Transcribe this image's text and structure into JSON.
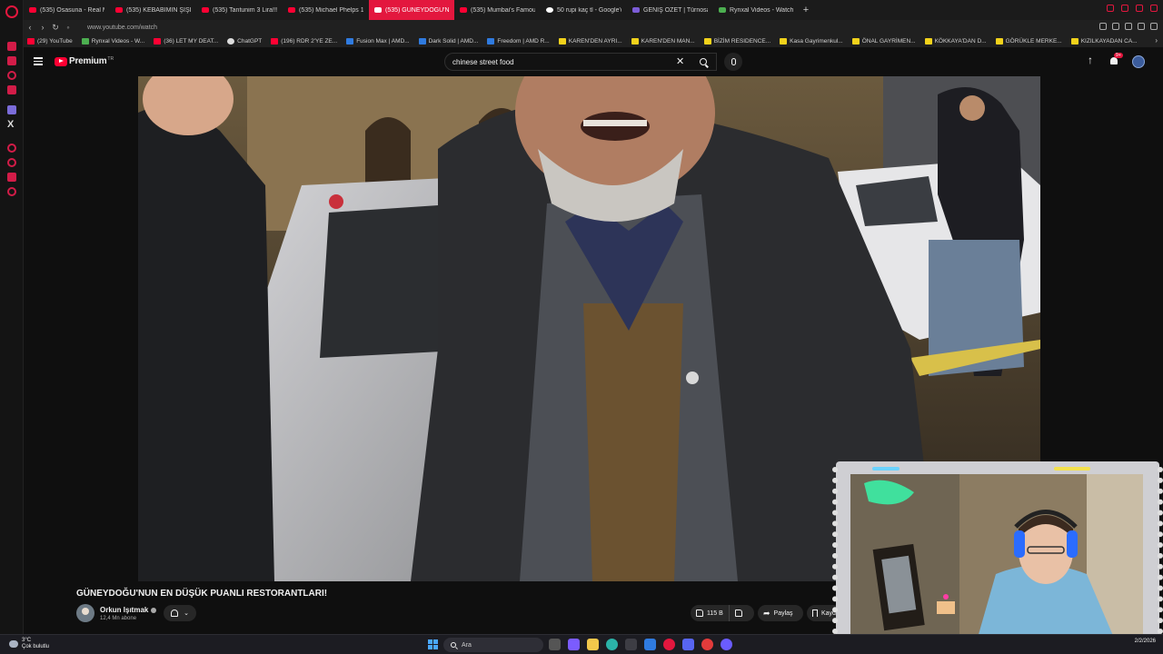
{
  "browser": {
    "tabs": [
      {
        "label": "(535) Osasuna - Real Mad",
        "icon": "youtube-icon",
        "active": false
      },
      {
        "label": "(535) KEBABIMIN ŞİŞİ 2,5",
        "icon": "youtube-icon",
        "active": false
      },
      {
        "label": "(535) Tantunim 3 Lira!!! Ç",
        "icon": "youtube-icon",
        "active": false
      },
      {
        "label": "(535) Michael Phelps 12,0",
        "icon": "youtube-icon",
        "active": false
      },
      {
        "label": "(535) GÜNEYDOĞU'N",
        "icon": "youtube-icon",
        "active": true
      },
      {
        "label": "(535) Mumbai's Famous",
        "icon": "youtube-icon",
        "active": false
      },
      {
        "label": "50 rupi kaç tl - Google'da",
        "icon": "google-icon",
        "active": false
      },
      {
        "label": "GENİŞ ÖZET | Türnosan K",
        "icon": "page-icon",
        "active": false
      },
      {
        "label": "Rynxal Videos - Watch On",
        "icon": "rynxal-icon",
        "active": false
      }
    ],
    "url": "www.youtube.com/watch",
    "bookmarks": [
      {
        "label": "(29) YouTube",
        "icon": "youtube-icon"
      },
      {
        "label": "Rynxal Videos - W...",
        "icon": "rynxal-icon"
      },
      {
        "label": "(36) LET MY DEAT...",
        "icon": "youtube-icon"
      },
      {
        "label": "ChatGPT",
        "icon": "chatgpt-icon"
      },
      {
        "label": "(196) RDR 2'YE ZE...",
        "icon": "youtube-icon"
      },
      {
        "label": "Fusion Max | AMD...",
        "icon": "amd-icon"
      },
      {
        "label": "Dark Solid | AMD...",
        "icon": "amd-icon"
      },
      {
        "label": "Freedom | AMD R...",
        "icon": "amd-icon"
      },
      {
        "label": "KAREN'DEN AYRI...",
        "icon": "sahibinden-icon"
      },
      {
        "label": "KAREN'DEN MAN...",
        "icon": "sahibinden-icon"
      },
      {
        "label": "BİZİM RESIDENCE...",
        "icon": "sahibinden-icon"
      },
      {
        "label": "Kasa Gayrimenkul...",
        "icon": "sahibinden-icon"
      },
      {
        "label": "ÖNAL GAYRİMEN...",
        "icon": "sahibinden-icon"
      },
      {
        "label": "KÖKKAYA'DAN D...",
        "icon": "sahibinden-icon"
      },
      {
        "label": "GÖRÜKLE MERKE...",
        "icon": "sahibinden-icon"
      },
      {
        "label": "KIZILKAYADAN CA...",
        "icon": "sahibinden-icon"
      }
    ]
  },
  "youtube": {
    "brand": "Premium",
    "region": "TR",
    "search_query": "chinese street food",
    "notification_badge": "9+"
  },
  "video": {
    "title": "GÜNEYDOĞU'NUN EN DÜŞÜK PUANLI RESTORANTLARI!",
    "channel": "Orkun Işıtmak",
    "subscribers": "12,4 Mn abone",
    "likes": "115 B",
    "share_label": "Paylaş",
    "save_label": "Kaydet"
  },
  "taskbar": {
    "weather_temp": "3°C",
    "weather_desc": "Çok bulutlu",
    "search_placeholder": "Ara",
    "date": "2/2/2026"
  },
  "colors": {
    "accent": "#e3173e",
    "youtube_red": "#ff0033",
    "background": "#0f0f0f"
  }
}
